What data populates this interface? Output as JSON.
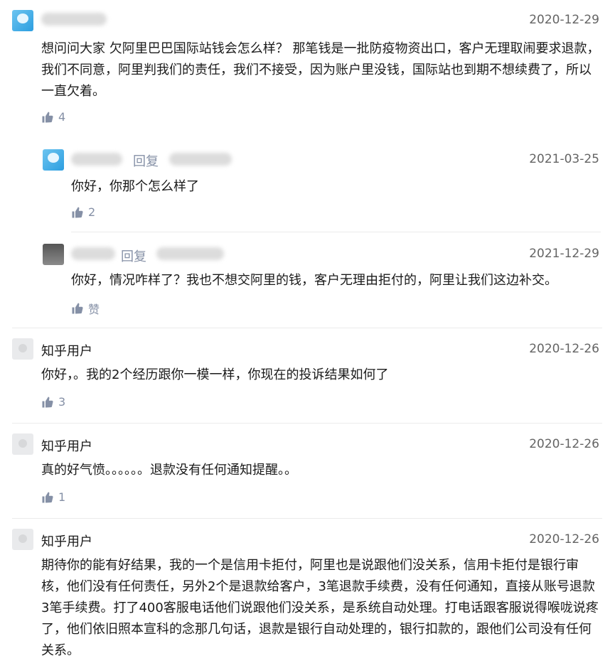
{
  "like_icon_color": "#8590a6",
  "comments": [
    {
      "author": "",
      "date": "2020-12-29",
      "text": "想问问大家 欠阿里巴巴国际站钱会怎么样？ 那笔钱是一批防疫物资出口，客户无理取闹要求退款，我们不同意，阿里判我们的责任，我们不接受，因为账户里没钱，国际站也到期不想续费了，所以一直欠着。",
      "likes": "4",
      "replies": [
        {
          "reply_word": "回复",
          "date": "2021-03-25",
          "text": "你好，你那个怎么样了",
          "likes": "2"
        },
        {
          "reply_word": "回复",
          "date": "2021-12-29",
          "text": "你好，情况咋样了？我也不想交阿里的钱，客户无理由拒付的，阿里让我们这边补交。",
          "likes": "赞"
        }
      ]
    },
    {
      "author": "知乎用户",
      "date": "2020-12-26",
      "text": "你好，。我的2个经历跟你一模一样，你现在的投诉结果如何了",
      "likes": "3"
    },
    {
      "author": "知乎用户",
      "date": "2020-12-26",
      "text": "真的好气愤。。。。。。退款没有任何通知提醒。。",
      "likes": "1"
    },
    {
      "author": "知乎用户",
      "date": "2020-12-26",
      "text": "期待你的能有好结果，我的一个是信用卡拒付，阿里也是说跟他们没关系，信用卡拒付是银行审核，他们没有任何责任，另外2个是退款给客户，3笔退款手续费，没有任何通知，直接从账号退款3笔手续费。打了400客服电话他们说跟他们没关系，是系统自动处理。打电话跟客服说得喉咙说疼了，他们依旧照本宣科的念那几句话，退款是银行自动处理的，银行扣款的，跟他们公司没有任何关系。"
    }
  ]
}
